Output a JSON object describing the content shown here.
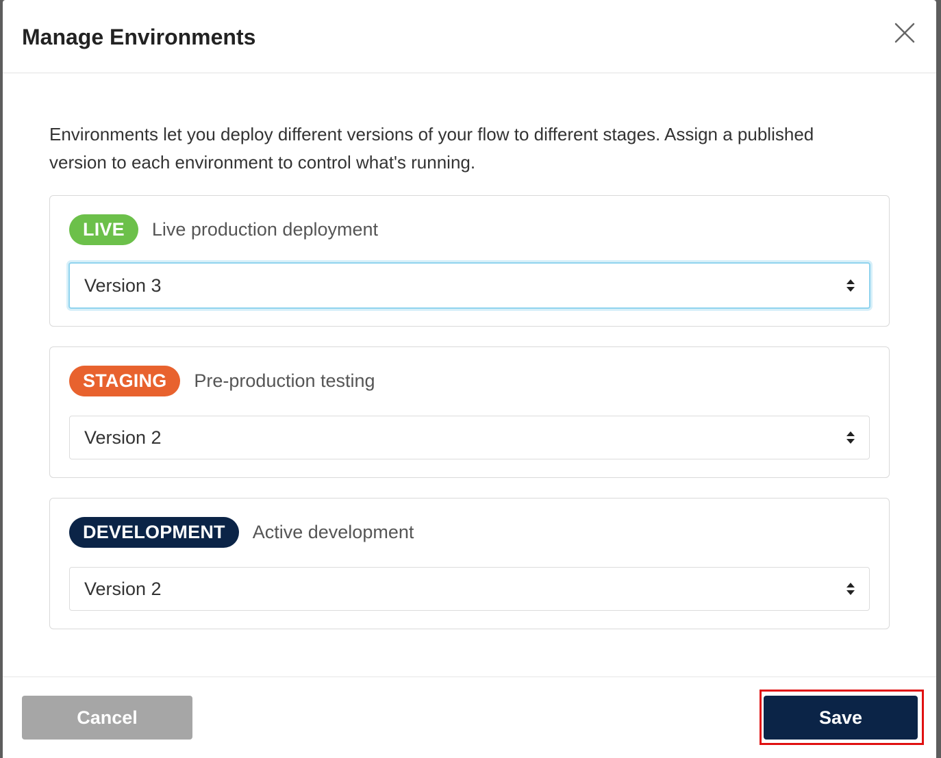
{
  "dialog": {
    "title": "Manage Environments",
    "description": "Environments let you deploy different versions of your flow to different stages. Assign a published version to each environment to control what's running."
  },
  "environments": [
    {
      "badge": "LIVE",
      "badge_color": "#6cc04a",
      "description": "Live production deployment",
      "selected_version": "Version 3",
      "focused": true
    },
    {
      "badge": "STAGING",
      "badge_color": "#e8622e",
      "description": "Pre-production testing",
      "selected_version": "Version 2",
      "focused": false
    },
    {
      "badge": "DEVELOPMENT",
      "badge_color": "#0b2447",
      "description": "Active development",
      "selected_version": "Version 2",
      "focused": false
    }
  ],
  "footer": {
    "cancel_label": "Cancel",
    "save_label": "Save"
  },
  "colors": {
    "primary": "#0b2447",
    "cancel": "#a6a6a6",
    "highlight": "#e01010",
    "focus_ring": "#8fd3ee"
  },
  "icons": {
    "close": "close-icon",
    "select_caret": "sort-caret-icon"
  }
}
